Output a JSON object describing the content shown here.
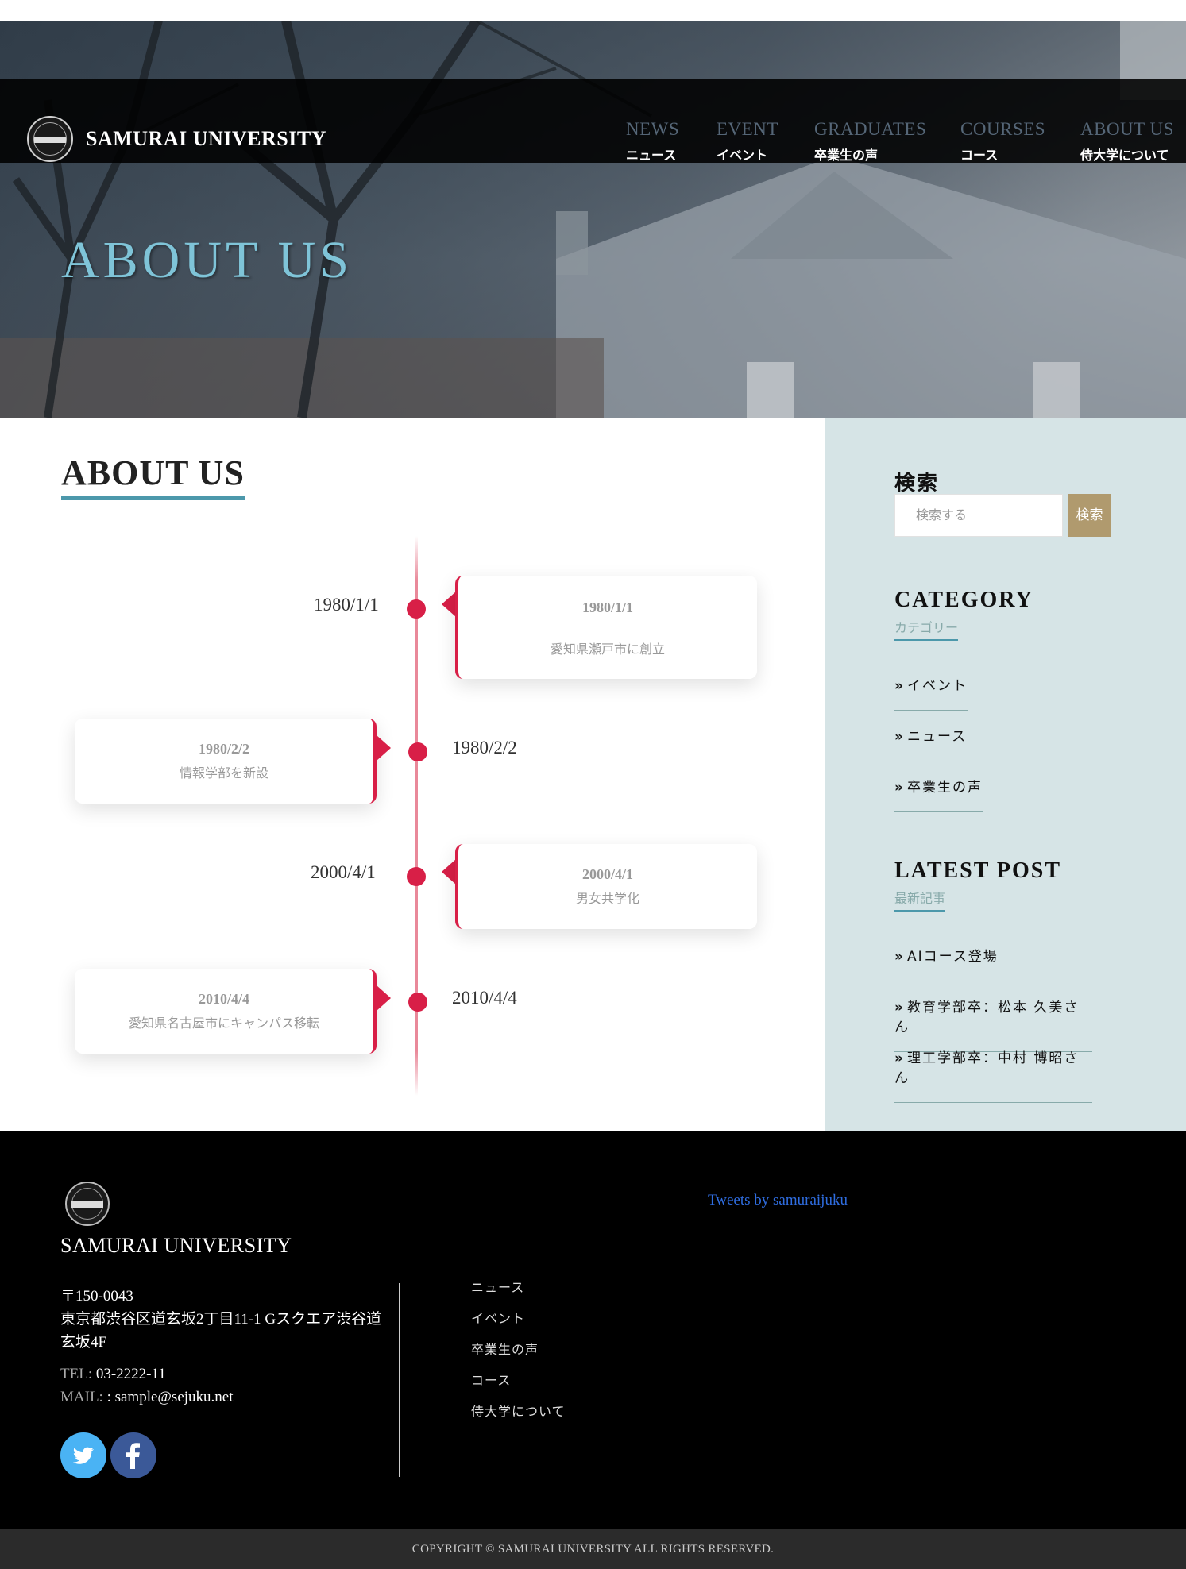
{
  "header": {
    "brand": "SAMURAI UNIVERSITY",
    "nav": [
      {
        "en": "NEWS",
        "jp": "ニュース"
      },
      {
        "en": "EVENT",
        "jp": "イベント"
      },
      {
        "en": "GRADUATES",
        "jp": "卒業生の声"
      },
      {
        "en": "COURSES",
        "jp": "コース"
      },
      {
        "en": "ABOUT US",
        "jp": "侍大学について"
      }
    ]
  },
  "hero": {
    "title": "ABOUT US"
  },
  "main": {
    "title": "ABOUT US",
    "timeline": [
      {
        "date": "1980/1/1",
        "card_date": "1980/1/1",
        "text": "愛知県瀬戸市に創立"
      },
      {
        "date": "1980/2/2",
        "card_date": "1980/2/2",
        "text": "情報学部を新設"
      },
      {
        "date": "2000/4/1",
        "card_date": "2000/4/1",
        "text": "男女共学化"
      },
      {
        "date": "2010/4/4",
        "card_date": "2010/4/4",
        "text": "愛知県名古屋市にキャンパス移転"
      }
    ]
  },
  "sidebar": {
    "search": {
      "heading": "検索",
      "placeholder": "検索する",
      "button": "検索"
    },
    "category": {
      "heading": "CATEGORY",
      "sub": "カテゴリー",
      "items": [
        "イベント",
        "ニュース",
        "卒業生の声"
      ]
    },
    "latest": {
      "heading": "LATEST POST",
      "sub": "最新記事",
      "items": [
        "AIコース登場",
        "教育学部卒：松本 久美さん",
        "理工学部卒：中村 博昭さん"
      ]
    },
    "chevron": "»"
  },
  "footer": {
    "brand": "SAMURAI UNIVERSITY",
    "postal": "〒150-0043",
    "address": "東京都渋谷区道玄坂2丁目11-1 Gスクエア渋谷道玄坂4F",
    "tel_label": "TEL:",
    "tel": "03-2222-11",
    "mail_label": "MAIL:",
    "mail": ": sample@sejuku.net",
    "links": [
      "ニュース",
      "イベント",
      "卒業生の声",
      "コース",
      "侍大学について"
    ],
    "tweets": "Tweets by samuraijuku",
    "copyright": "COPYRIGHT © SAMURAI UNIVERSITY ALL RIGHTS RESERVED."
  },
  "colors": {
    "accent_teal": "#4c98ab",
    "timeline_red": "#d81f47",
    "search_button": "#b09a6e",
    "sidebar_bg": "#d6e4e6",
    "twitter": "#4ab3f4",
    "facebook": "#3b5998"
  },
  "icons": {
    "logo": "university-emblem-icon",
    "twitter": "twitter-icon",
    "facebook": "facebook-icon"
  }
}
